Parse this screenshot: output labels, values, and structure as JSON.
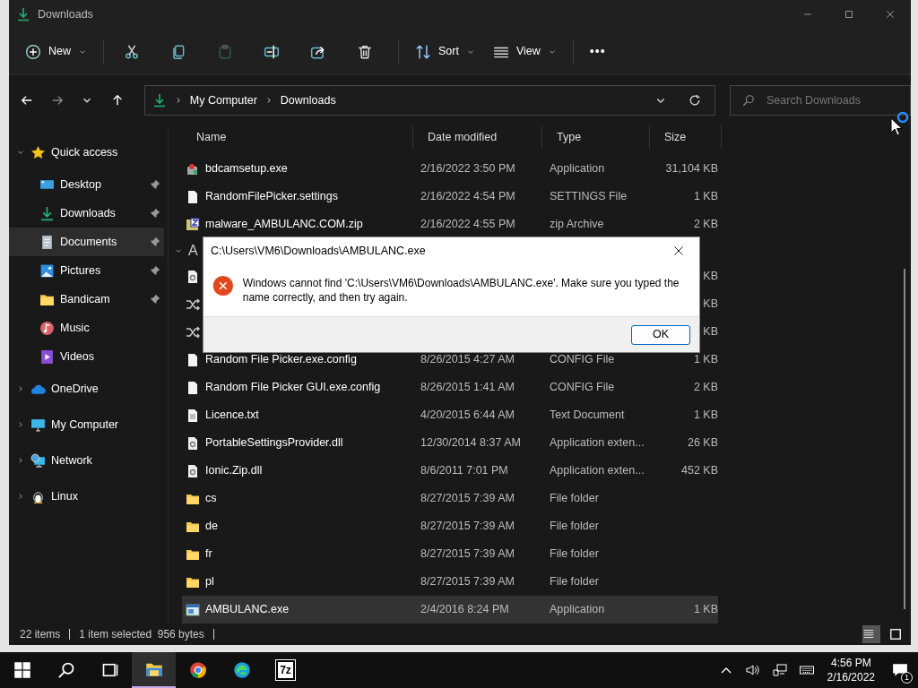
{
  "window": {
    "title": "Downloads"
  },
  "toolbar": [
    {
      "kind": "menu",
      "label": "New",
      "disabled": false
    },
    {
      "kind": "icon",
      "disabled": false
    },
    {
      "kind": "icon",
      "disabled": false
    },
    {
      "kind": "icon",
      "disabled": true
    },
    {
      "kind": "icon",
      "disabled": false
    },
    {
      "kind": "icon",
      "disabled": false
    },
    {
      "kind": "icon",
      "disabled": false
    },
    {
      "kind": "menu",
      "label": "Sort",
      "disabled": false
    },
    {
      "kind": "menu",
      "label": "View",
      "disabled": false
    },
    {
      "kind": "more",
      "label": "•••",
      "disabled": false
    }
  ],
  "address": {
    "crumbs": [
      "My Computer",
      "Downloads"
    ]
  },
  "search": {
    "placeholder": "Search Downloads"
  },
  "sidebar": {
    "items": [
      {
        "label": "Quick access",
        "expanded": true,
        "selected": false,
        "children": [
          {
            "label": "Desktop",
            "pinned": true,
            "selected": false
          },
          {
            "label": "Downloads",
            "pinned": true,
            "selected": false
          },
          {
            "label": "Documents",
            "pinned": true,
            "selected": true
          },
          {
            "label": "Pictures",
            "pinned": true,
            "selected": false
          },
          {
            "label": "Bandicam",
            "pinned": true,
            "selected": false
          },
          {
            "label": "Music",
            "pinned": false,
            "selected": false
          },
          {
            "label": "Videos",
            "pinned": false,
            "selected": false
          }
        ]
      },
      {
        "label": "OneDrive",
        "expanded": false,
        "selected": false
      },
      {
        "label": "My Computer",
        "expanded": false,
        "selected": false
      },
      {
        "label": "Network",
        "expanded": false,
        "selected": false
      },
      {
        "label": "Linux",
        "expanded": false,
        "selected": false
      }
    ]
  },
  "table": {
    "columns": [
      "Name",
      "Date modified",
      "Type",
      "Size"
    ],
    "rows": [
      {
        "kind": "installer",
        "name": "bdcamsetup.exe",
        "date": "2/16/2022 3:50 PM",
        "type": "Application",
        "size": "31,104 KB",
        "selected": false
      },
      {
        "kind": "blank",
        "name": "RandomFilePicker.settings",
        "date": "2/16/2022 4:54 PM",
        "type": "SETTINGS File",
        "size": "1 KB",
        "selected": false
      },
      {
        "kind": "zip",
        "name": "malware_AMBULANC.COM.zip",
        "date": "2/16/2022 4:55 PM",
        "type": "zip Archive",
        "size": "2 KB",
        "selected": false
      },
      {
        "kind": "group",
        "label": "A"
      },
      {
        "kind": "dll",
        "size": "KB",
        "selected": false
      },
      {
        "kind": "shuffle",
        "size": "KB",
        "selected": false
      },
      {
        "kind": "shuffle",
        "size": "KB",
        "selected": false
      },
      {
        "kind": "blank",
        "name": "Random File Picker.exe.config",
        "date": "8/26/2015 4:27 AM",
        "type": "CONFIG File",
        "size": "1 KB",
        "selected": false
      },
      {
        "kind": "blank",
        "name": "Random File Picker GUI.exe.config",
        "date": "8/26/2015 1:41 AM",
        "type": "CONFIG File",
        "size": "2 KB",
        "selected": false
      },
      {
        "kind": "text",
        "name": "Licence.txt",
        "date": "4/20/2015 6:44 AM",
        "type": "Text Document",
        "size": "1 KB",
        "selected": false
      },
      {
        "kind": "dll",
        "name": "PortableSettingsProvider.dll",
        "date": "12/30/2014 8:37 AM",
        "type": "Application exten...",
        "size": "26 KB",
        "selected": false
      },
      {
        "kind": "dll",
        "name": "Ionic.Zip.dll",
        "date": "8/6/2011 7:01 PM",
        "type": "Application exten...",
        "size": "452 KB",
        "selected": false
      },
      {
        "kind": "folder",
        "name": "cs",
        "date": "8/27/2015 7:39 AM",
        "type": "File folder",
        "selected": false
      },
      {
        "kind": "folder",
        "name": "de",
        "date": "8/27/2015 7:39 AM",
        "type": "File folder",
        "selected": false
      },
      {
        "kind": "folder",
        "name": "fr",
        "date": "8/27/2015 7:39 AM",
        "type": "File folder",
        "selected": false
      },
      {
        "kind": "folder",
        "name": "pl",
        "date": "8/27/2015 7:39 AM",
        "type": "File folder",
        "selected": false
      },
      {
        "kind": "app",
        "name": "AMBULANC.exe",
        "date": "2/4/2016 8:24 PM",
        "type": "Application",
        "size": "1 KB",
        "selected": true
      }
    ]
  },
  "status_bar": {
    "items": "22 items",
    "selection": "1 item selected  956 bytes"
  },
  "dialog": {
    "title": "C:\\Users\\VM6\\Downloads\\AMBULANC.exe",
    "message": "Windows cannot find 'C:\\Users\\VM6\\Downloads\\AMBULANC.exe'. Make sure you typed the name correctly, and then try again.",
    "button": "OK"
  },
  "taskbar": {
    "apps": [
      {
        "kind": "icon",
        "selected": true
      },
      {
        "kind": "icon",
        "selected": false
      },
      {
        "kind": "icon",
        "selected": false
      },
      {
        "kind": "text",
        "label": "7z",
        "selected": false
      }
    ],
    "time": "4:56 PM",
    "date": "2/16/2022",
    "notifications": "1"
  }
}
